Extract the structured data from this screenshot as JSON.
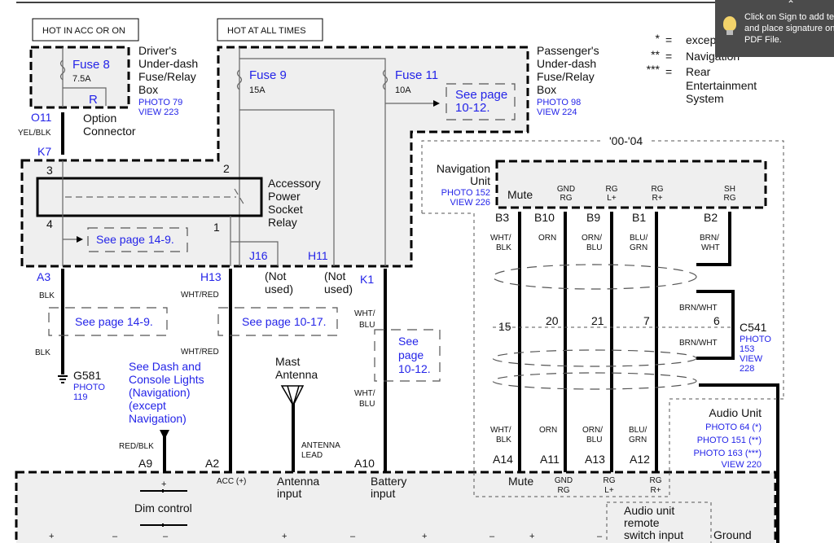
{
  "domain_note": "",
  "headers": {
    "hot_acc": "HOT IN ACC OR ON",
    "hot_all": "HOT AT ALL TIMES"
  },
  "legend": [
    {
      "sym": "*",
      "eq": "=",
      "text": [
        "except Navigation"
      ]
    },
    {
      "sym": "**",
      "eq": "=",
      "text": [
        "Navigation"
      ]
    },
    {
      "sym": "***",
      "eq": "=",
      "text": [
        "Rear",
        "Entertainment",
        "System"
      ]
    }
  ],
  "driver_box": {
    "lines": [
      "Driver's",
      "Under-dash",
      "Fuse/Relay",
      "Box"
    ],
    "photo": "PHOTO 79",
    "view": "VIEW 223",
    "fuse": "Fuse 8",
    "amps": "7.5A",
    "r": "R"
  },
  "option": {
    "pin_top": "O11",
    "wire": "YEL/BLK",
    "lines": [
      "Option",
      "Connector"
    ],
    "pin_bottom": "K7"
  },
  "pass_box": {
    "lines": [
      "Passenger's",
      "Under-dash",
      "Fuse/Relay",
      "Box"
    ],
    "photo": "PHOTO 98",
    "view": "VIEW 224",
    "fuse9": "Fuse 9",
    "amps9": "15A",
    "fuse11": "Fuse 11",
    "amps11": "10A",
    "see": [
      "See page",
      "10-12."
    ]
  },
  "relay": {
    "lines": [
      "Accessory",
      "Power",
      "Socket",
      "Relay"
    ],
    "pins": [
      "3",
      "2",
      "4",
      "1"
    ],
    "see": "See page 14-9.",
    "j16": "J16",
    "h11": "H11"
  },
  "left": {
    "a3": "A3",
    "blk1": "BLK",
    "see": "See page 14-9.",
    "blk2": "BLK",
    "ground": "G581",
    "photo": [
      "PHOTO",
      "119"
    ]
  },
  "mid": {
    "h13": "H13",
    "wr1": "WHT/RED",
    "see": "See page 10-17.",
    "wr2": "WHT/RED",
    "a2": "A2",
    "acc": "ACC (+)",
    "not_used1": [
      "(Not",
      "used)"
    ],
    "not_used2": [
      "(Not",
      "used)"
    ],
    "k1": "K1",
    "wb1": [
      "WHT/",
      "BLU"
    ],
    "see2": [
      "See",
      "page",
      "10-12."
    ],
    "wb2": [
      "WHT/",
      "BLU"
    ],
    "a10": "A10"
  },
  "dash": {
    "lines": [
      "See Dash and",
      "Console Lights",
      "(Navigation)",
      "(except",
      "Navigation)"
    ],
    "wire": "RED/BLK",
    "pin": "A9"
  },
  "antenna": {
    "lines": [
      "Mast",
      "Antenna"
    ],
    "lead": [
      "ANTENNA",
      "LEAD"
    ]
  },
  "nav": {
    "range": "'00-'04",
    "lines": [
      "Navigation",
      "Unit"
    ],
    "photo": "PHOTO 152",
    "view": "VIEW 226",
    "terminals": [
      [
        "Mute"
      ],
      [
        "GND",
        "RG"
      ],
      [
        "RG",
        "L+"
      ],
      [
        "RG",
        "R+"
      ],
      [
        "SH",
        "RG"
      ]
    ],
    "pins": [
      "B3",
      "B10",
      "B9",
      "B1",
      "B2"
    ],
    "wires": [
      [
        "WHT/",
        "BLK"
      ],
      [
        "ORN"
      ],
      [
        "ORN/",
        "BLU"
      ],
      [
        "BLU/",
        "GRN"
      ],
      [
        "BRN/",
        "WHT"
      ]
    ]
  },
  "c541": {
    "pins": [
      "15",
      "20",
      "21",
      "7",
      "6"
    ],
    "name": "C541",
    "photo": [
      "PHOTO",
      "153",
      "VIEW",
      "228"
    ],
    "brn1": "BRN/WHT",
    "brn2": "BRN/WHT"
  },
  "audio": {
    "title": "Audio Unit",
    "photos": [
      "PHOTO 64 (*)",
      "PHOTO 151 (**)",
      "PHOTO 163 (***)",
      "VIEW 220"
    ],
    "wires": [
      [
        "WHT/",
        "BLK"
      ],
      [
        "ORN"
      ],
      [
        "ORN/",
        "BLU"
      ],
      [
        "BLU/",
        "GRN"
      ]
    ],
    "pins": [
      "A14",
      "A11",
      "A13",
      "A12"
    ],
    "terminals": {
      "plus": "+",
      "dim": "Dim control",
      "minus": "–",
      "ant": [
        "Antenna",
        "input"
      ],
      "bat": [
        "Battery",
        "input"
      ],
      "mute": "Mute",
      "gnd": [
        "GND",
        "RG"
      ],
      "rgl": [
        "RG",
        "L+"
      ],
      "rgr": [
        "RG",
        "R+"
      ],
      "remote": [
        "Audio unit",
        "remote",
        "switch input"
      ],
      "ground": "Ground"
    },
    "polarity": [
      "+",
      "–",
      "–",
      "+",
      "–",
      "+",
      "–",
      "+",
      "–"
    ]
  },
  "tooltip": {
    "lines": [
      "Click on Sign to add text",
      "and place signature on",
      "PDF File."
    ],
    "icon": "lightbulb-icon"
  }
}
